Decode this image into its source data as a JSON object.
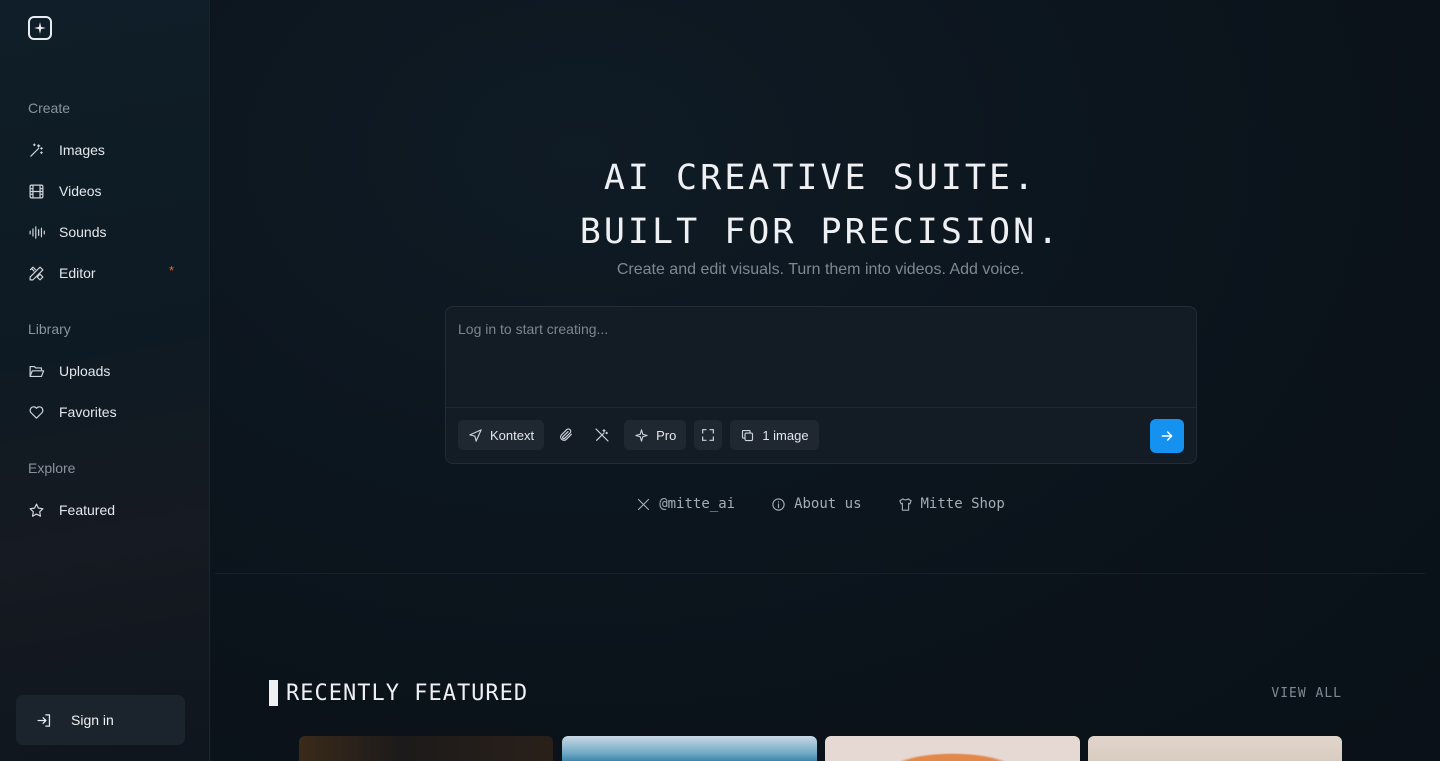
{
  "sidebar": {
    "sections": [
      {
        "label": "Create",
        "items": [
          {
            "label": "Images",
            "icon": "magic-wand-icon"
          },
          {
            "label": "Videos",
            "icon": "film-icon"
          },
          {
            "label": "Sounds",
            "icon": "audio-waveform-icon"
          },
          {
            "label": "Editor",
            "icon": "pencil-ruler-icon",
            "badge": "*"
          }
        ]
      },
      {
        "label": "Library",
        "items": [
          {
            "label": "Uploads",
            "icon": "folder-open-icon"
          },
          {
            "label": "Favorites",
            "icon": "heart-icon"
          }
        ]
      },
      {
        "label": "Explore",
        "items": [
          {
            "label": "Featured",
            "icon": "star-icon"
          }
        ]
      }
    ],
    "sign_in_label": "Sign in"
  },
  "hero": {
    "title_line1": "AI CREATIVE SUITE.",
    "title_line2": "BUILT FOR PRECISION.",
    "subtitle": "Create and edit visuals. Turn them into videos. Add voice."
  },
  "prompt": {
    "placeholder": "Log in to start creating...",
    "model_label": "Kontext",
    "quality_label": "Pro",
    "count_label": "1 image"
  },
  "links": {
    "twitter": "@mitte_ai",
    "about": "About us",
    "shop": "Mitte Shop"
  },
  "featured": {
    "title": "RECENTLY FEATURED",
    "view_all": "VIEW ALL"
  },
  "colors": {
    "accent": "#1592f0",
    "badge": "#f0642c",
    "background": "#0c141c"
  }
}
